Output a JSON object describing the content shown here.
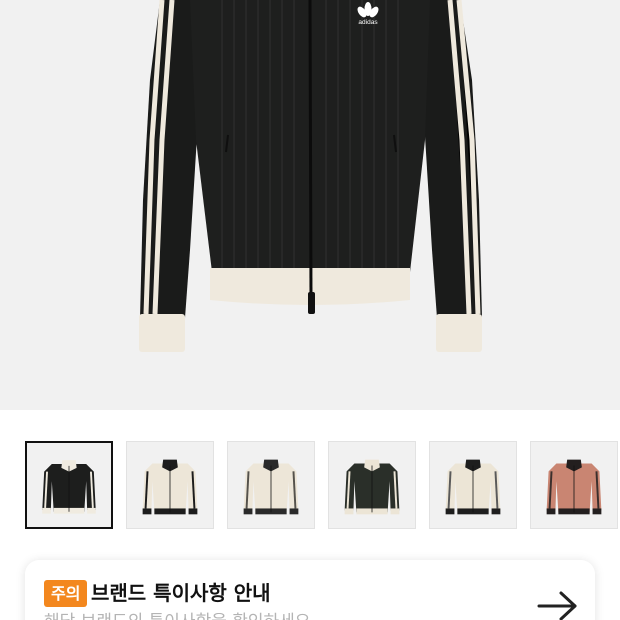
{
  "product": {
    "image_icon": "track-jacket-photo",
    "brand_logo_icon": "adidas-trefoil-logo",
    "logo_text": "adidas"
  },
  "thumbnails": [
    {
      "icon": "jacket-thumbnail",
      "body": "#1d1e1d",
      "trim": "#f0ebe0",
      "stripe": "#f0ebe0",
      "collar": "#f0ebe0",
      "selected": true
    },
    {
      "icon": "jacket-thumbnail",
      "body": "#ede6d8",
      "trim": "#1c1c1c",
      "stripe": "#1c1c1c",
      "collar": "#1c1c1c",
      "selected": false
    },
    {
      "icon": "jacket-thumbnail",
      "body": "#ede6d8",
      "trim": "#2a2a2a",
      "stripe": "#55524c",
      "collar": "#2a2a2a",
      "selected": false
    },
    {
      "icon": "jacket-thumbnail",
      "body": "#2a2f29",
      "trim": "#ece5d6",
      "stripe": "#ece5d6",
      "collar": "#ece5d6",
      "selected": false
    },
    {
      "icon": "jacket-thumbnail",
      "body": "#ece5d6",
      "trim": "#1e1e1e",
      "stripe": "#5a5a5a",
      "collar": "#1e1e1e",
      "selected": false
    },
    {
      "icon": "jacket-thumbnail",
      "body": "#c98572",
      "trim": "#231f1f",
      "stripe": "#3b2f2c",
      "collar": "#231f1f",
      "selected": false
    }
  ],
  "notice": {
    "badge": "주의",
    "title": "브랜드 특이사항 안내",
    "subtitle": "해당 브랜드의 특이사항을 확인하세요",
    "arrow_icon": "arrow-right-icon",
    "badge_color": "#f3871e"
  }
}
